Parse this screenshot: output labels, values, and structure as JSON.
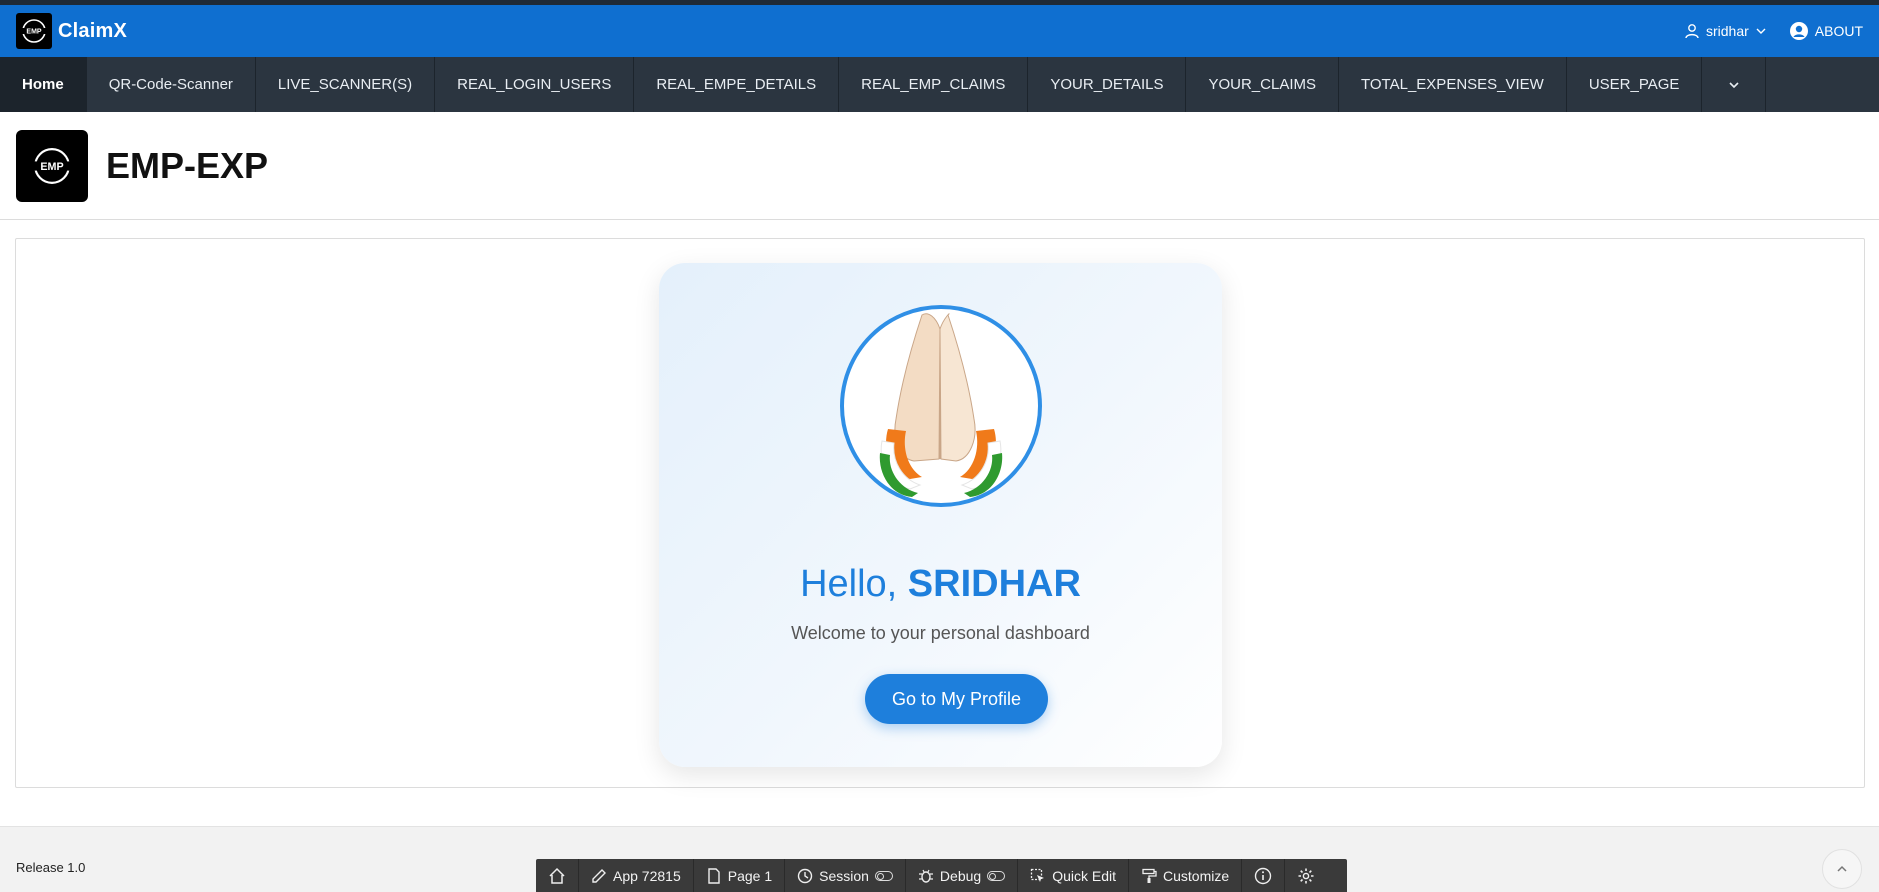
{
  "header": {
    "app_name": "ClaimX",
    "logo_text": "EMP",
    "user_label": "sridhar",
    "about_label": "ABOUT"
  },
  "nav": {
    "items": [
      {
        "label": "Home"
      },
      {
        "label": "QR-Code-Scanner"
      },
      {
        "label": "LIVE_SCANNER(S)"
      },
      {
        "label": "REAL_LOGIN_USERS"
      },
      {
        "label": "REAL_EMPE_DETAILS"
      },
      {
        "label": "REAL_EMP_CLAIMS"
      },
      {
        "label": "YOUR_DETAILS"
      },
      {
        "label": "YOUR_CLAIMS"
      },
      {
        "label": "TOTAL_EXPENSES_VIEW"
      },
      {
        "label": "USER_PAGE"
      }
    ]
  },
  "page": {
    "logo_text": "EMP",
    "title": "EMP-EXP"
  },
  "card": {
    "greeting_prefix": "Hello, ",
    "greeting_name": "SRIDHAR",
    "subtitle": "Welcome to your personal dashboard",
    "button_label": "Go to My Profile"
  },
  "footer": {
    "release": "Release 1.0",
    "devbar": {
      "app": "App 72815",
      "page": "Page 1",
      "session": "Session",
      "debug": "Debug",
      "quick_edit": "Quick Edit",
      "customize": "Customize"
    }
  },
  "colors": {
    "header_blue": "#0f6fd0",
    "nav_dark": "#2b3540",
    "accent_blue": "#1e7fdc",
    "dev_toolbar": "#3a3a3a"
  }
}
